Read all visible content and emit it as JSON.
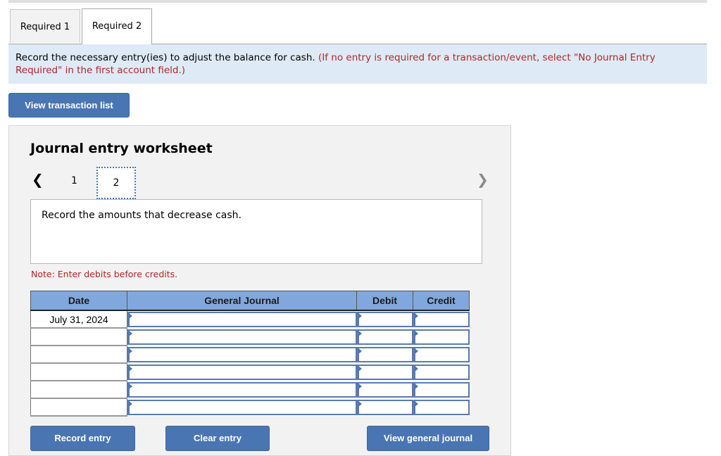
{
  "tabs": [
    {
      "label": "Required 1",
      "active": false
    },
    {
      "label": "Required 2",
      "active": true
    }
  ],
  "instructions": {
    "main": "Record the necessary entry(ies) to adjust the balance for cash.",
    "note": "(If no entry is required for a transaction/event, select \"No Journal Entry Required\" in the first account field.)"
  },
  "buttons": {
    "view_transaction_list": "View transaction list",
    "record_entry": "Record entry",
    "clear_entry": "Clear entry",
    "view_general_journal": "View general journal"
  },
  "worksheet": {
    "title": "Journal entry worksheet",
    "prev_icon": "<",
    "next_icon": ">",
    "pages": [
      "1",
      "2"
    ],
    "current_page": "2",
    "description": "Record the amounts that decrease cash.",
    "note": "Note: Enter debits before credits."
  },
  "table": {
    "headers": {
      "date": "Date",
      "general_journal": "General Journal",
      "debit": "Debit",
      "credit": "Credit"
    },
    "rows": [
      {
        "date": "July 31, 2024",
        "account": "",
        "debit": "",
        "credit": ""
      },
      {
        "date": "",
        "account": "",
        "debit": "",
        "credit": ""
      },
      {
        "date": "",
        "account": "",
        "debit": "",
        "credit": ""
      },
      {
        "date": "",
        "account": "",
        "debit": "",
        "credit": ""
      },
      {
        "date": "",
        "account": "",
        "debit": "",
        "credit": ""
      },
      {
        "date": "",
        "account": "",
        "debit": "",
        "credit": ""
      }
    ]
  },
  "colors": {
    "accent": "#4a75b3",
    "header_blue": "#81a8dc",
    "instruction_bg": "#deeaf6",
    "note_red": "#b02727"
  }
}
